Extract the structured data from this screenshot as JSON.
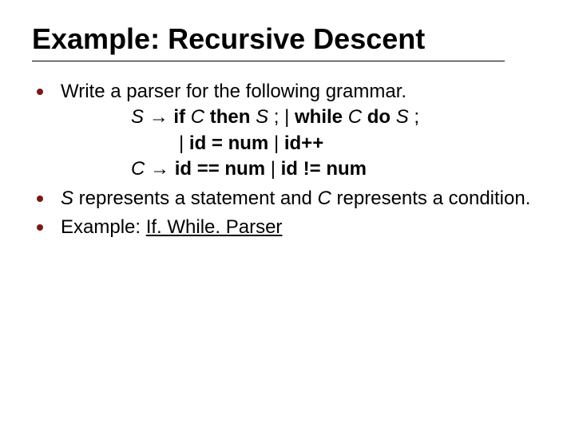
{
  "title": "Example: Recursive Descent",
  "b1": {
    "intro": "Write a parser for the following grammar.",
    "g1_S": "S",
    "g1_arrow": "→",
    "g1_ifkw": "if",
    "g1_C": "C",
    "g1_thenkw": "then",
    "g1_S2": "S",
    "g1_semi1": ";",
    "g1_bar": "|",
    "g1_whilekw": "while",
    "g1_C2": "C",
    "g1_dokw": "do",
    "g1_S3": "S",
    "g1_semi2": ";",
    "g2_bar1": "|",
    "g2_id1": "id",
    "g2_eq": "=",
    "g2_num": "num",
    "g2_bar2": "|",
    "g2_id2": "id++",
    "g3_C": "C",
    "g3_arrow": "→",
    "g3_id1": "id",
    "g3_eqeq": "==",
    "g3_num1": "num",
    "g3_bar": "|",
    "g3_id2": "id",
    "g3_neq": "!=",
    "g3_num2": "num"
  },
  "b2": {
    "S": "S",
    "mid1": " represents a statement and ",
    "C": "C",
    "mid2": " represents a condition."
  },
  "b3": {
    "label": "Example: ",
    "link": "If. While. Parser"
  }
}
